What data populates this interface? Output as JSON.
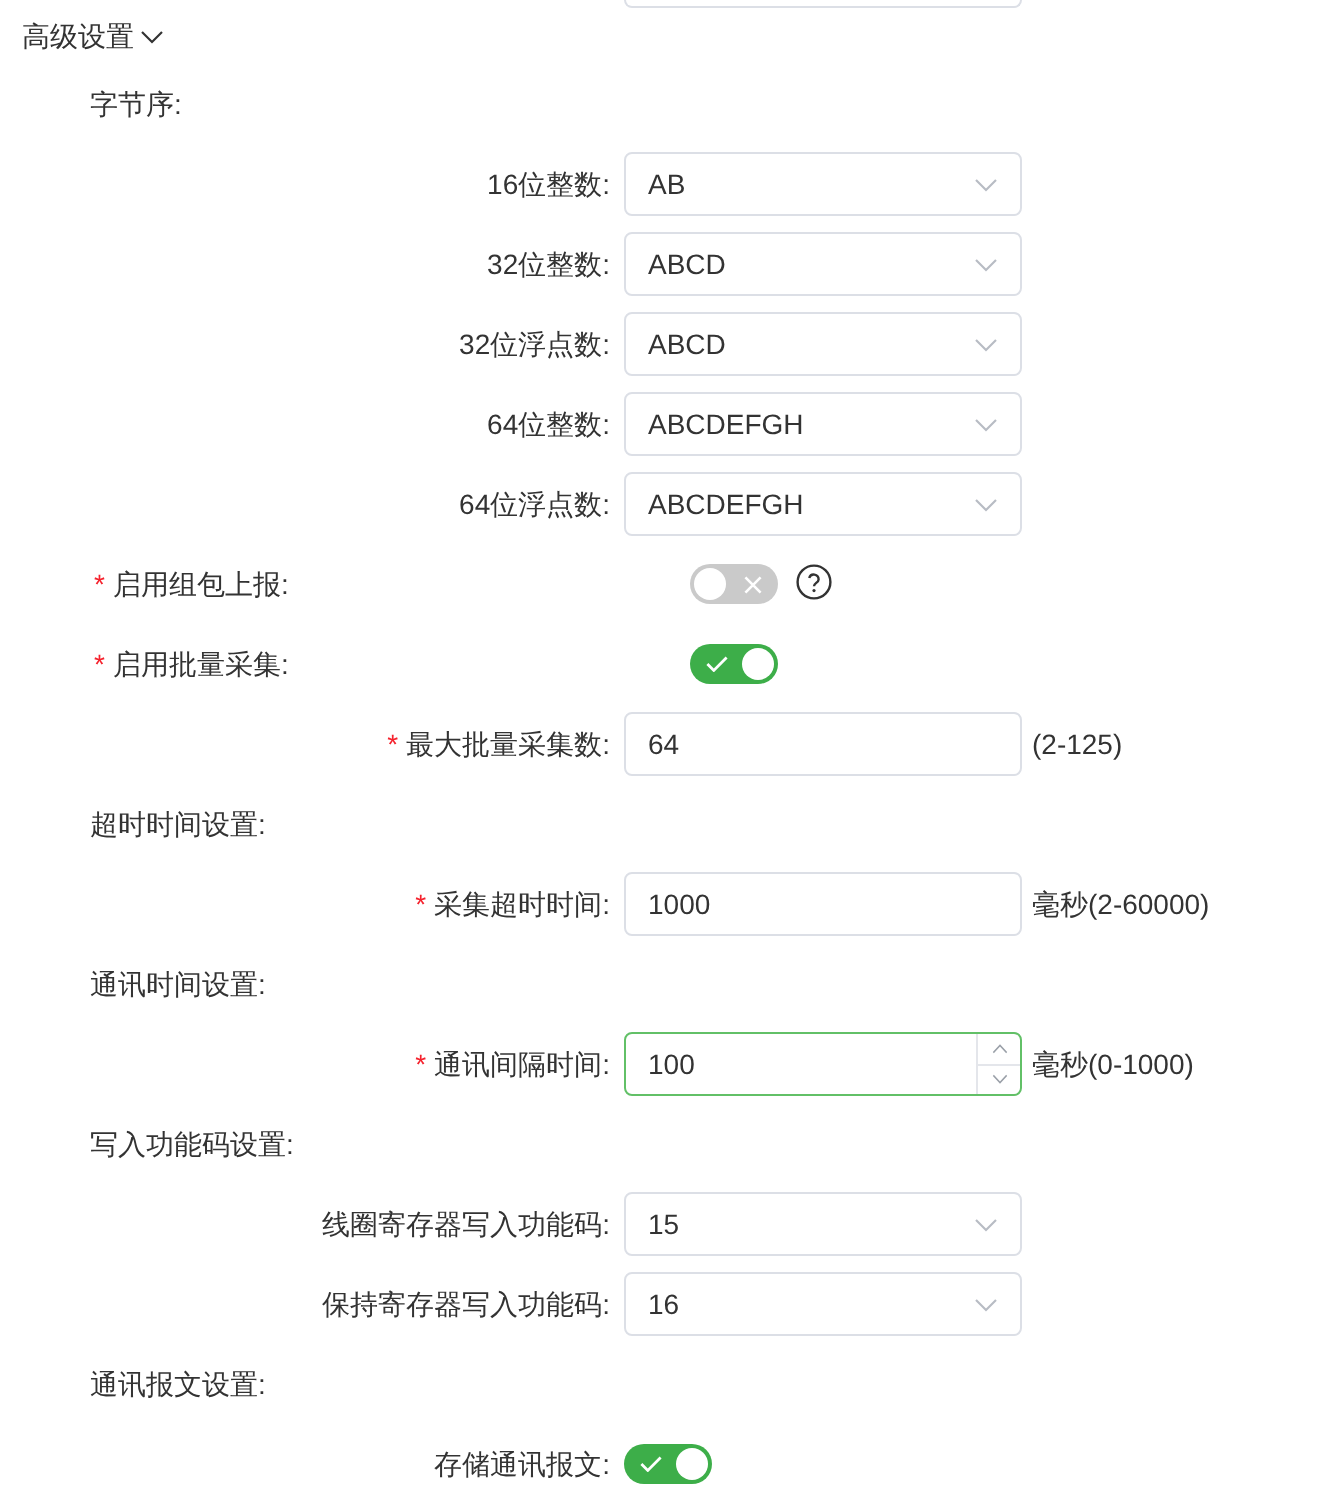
{
  "section": {
    "title": "高级设置",
    "expanded": true
  },
  "rows": [
    {
      "kind": "heading",
      "label": "字节序:"
    },
    {
      "kind": "select",
      "label": "16位整数:",
      "value": "AB"
    },
    {
      "kind": "select",
      "label": "32位整数:",
      "value": "ABCD"
    },
    {
      "kind": "select",
      "label": "32位浮点数:",
      "value": "ABCD"
    },
    {
      "kind": "select",
      "label": "64位整数:",
      "value": "ABCDEFGH"
    },
    {
      "kind": "select",
      "label": "64位浮点数:",
      "value": "ABCDEFGH"
    },
    {
      "kind": "toggle",
      "required_mark": "*",
      "label": "启用组包上报:",
      "on": false,
      "help": true
    },
    {
      "kind": "toggle",
      "required_mark": "*",
      "label": "启用批量采集:",
      "on": true,
      "help": false
    },
    {
      "kind": "input",
      "required_mark": "*",
      "label": "最大批量采集数:",
      "value": "64",
      "suffix": "(2-125)",
      "focused": false
    },
    {
      "kind": "heading",
      "label": "超时时间设置:"
    },
    {
      "kind": "input",
      "required_mark": "*",
      "label": "采集超时时间:",
      "value": "1000",
      "suffix": "毫秒(2-60000)",
      "focused": false
    },
    {
      "kind": "heading",
      "label": "通讯时间设置:"
    },
    {
      "kind": "number",
      "required_mark": "*",
      "label": "通讯间隔时间:",
      "value": "100",
      "suffix": "毫秒(0-1000)",
      "focused": true
    },
    {
      "kind": "heading",
      "label": "写入功能码设置:"
    },
    {
      "kind": "select",
      "label": "线圈寄存器写入功能码:",
      "value": "15"
    },
    {
      "kind": "select",
      "label": "保持寄存器写入功能码:",
      "value": "16"
    },
    {
      "kind": "heading",
      "label": "通讯报文设置:"
    },
    {
      "kind": "switch",
      "label": "存储通讯报文:",
      "on": true,
      "help": false
    }
  ]
}
